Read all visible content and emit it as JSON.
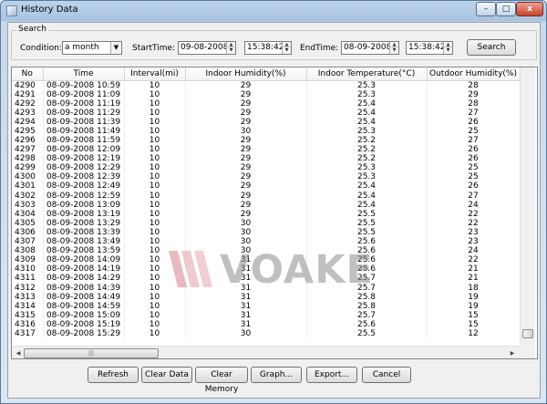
{
  "window": {
    "title": "History Data",
    "min": "–",
    "max": "□",
    "close": "x"
  },
  "search": {
    "group_label": "Search",
    "condition_label": "Condition:",
    "condition_value": "a month",
    "start_label": "StartTime:",
    "start_date": "09-08-2008",
    "start_time": "15:38:42",
    "end_label": "EndTime:",
    "end_date": "08-09-2008",
    "end_time": "15:38:42",
    "search_button": "Search"
  },
  "table": {
    "columns": [
      "No",
      "Time",
      "Interval(mi)",
      "Indoor Humidity(%)",
      "Indoor Temperature(°C)",
      "Outdoor Humidity(%)"
    ],
    "rows": [
      [
        "4290",
        "08-09-2008 10:59",
        "10",
        "29",
        "25.3",
        "28"
      ],
      [
        "4291",
        "08-09-2008 11:09",
        "10",
        "29",
        "25.3",
        "29"
      ],
      [
        "4292",
        "08-09-2008 11:19",
        "10",
        "29",
        "25.4",
        "28"
      ],
      [
        "4293",
        "08-09-2008 11:29",
        "10",
        "29",
        "25.4",
        "27"
      ],
      [
        "4294",
        "08-09-2008 11:39",
        "10",
        "29",
        "25.4",
        "26"
      ],
      [
        "4295",
        "08-09-2008 11:49",
        "10",
        "30",
        "25.3",
        "25"
      ],
      [
        "4296",
        "08-09-2008 11:59",
        "10",
        "29",
        "25.2",
        "27"
      ],
      [
        "4297",
        "08-09-2008 12:09",
        "10",
        "29",
        "25.2",
        "26"
      ],
      [
        "4298",
        "08-09-2008 12:19",
        "10",
        "29",
        "25.2",
        "26"
      ],
      [
        "4299",
        "08-09-2008 12:29",
        "10",
        "29",
        "25.3",
        "25"
      ],
      [
        "4300",
        "08-09-2008 12:39",
        "10",
        "29",
        "25.3",
        "25"
      ],
      [
        "4301",
        "08-09-2008 12:49",
        "10",
        "29",
        "25.4",
        "26"
      ],
      [
        "4302",
        "08-09-2008 12:59",
        "10",
        "29",
        "25.4",
        "27"
      ],
      [
        "4303",
        "08-09-2008 13:09",
        "10",
        "29",
        "25.4",
        "24"
      ],
      [
        "4304",
        "08-09-2008 13:19",
        "10",
        "29",
        "25.5",
        "22"
      ],
      [
        "4305",
        "08-09-2008 13:29",
        "10",
        "30",
        "25.5",
        "22"
      ],
      [
        "4306",
        "08-09-2008 13:39",
        "10",
        "30",
        "25.5",
        "23"
      ],
      [
        "4307",
        "08-09-2008 13:49",
        "10",
        "30",
        "25.6",
        "23"
      ],
      [
        "4308",
        "08-09-2008 13:59",
        "10",
        "30",
        "25.6",
        "24"
      ],
      [
        "4309",
        "08-09-2008 14:09",
        "10",
        "31",
        "25.6",
        "22"
      ],
      [
        "4310",
        "08-09-2008 14:19",
        "10",
        "31",
        "25.6",
        "21"
      ],
      [
        "4311",
        "08-09-2008 14:29",
        "10",
        "31",
        "25.7",
        "21"
      ],
      [
        "4312",
        "08-09-2008 14:39",
        "10",
        "31",
        "25.7",
        "18"
      ],
      [
        "4313",
        "08-09-2008 14:49",
        "10",
        "31",
        "25.8",
        "19"
      ],
      [
        "4314",
        "08-09-2008 14:59",
        "10",
        "31",
        "25.8",
        "19"
      ],
      [
        "4315",
        "08-09-2008 15:09",
        "10",
        "31",
        "25.7",
        "15"
      ],
      [
        "4316",
        "08-09-2008 15:19",
        "10",
        "31",
        "25.6",
        "15"
      ],
      [
        "4317",
        "08-09-2008 15:29",
        "10",
        "30",
        "25.5",
        "12"
      ]
    ]
  },
  "watermark": "VOAKE",
  "buttons": {
    "refresh": "Refresh",
    "clear_data": "Clear Data",
    "clear_memory": "Clear Memory",
    "graph": "Graph...",
    "export": "Export...",
    "cancel": "Cancel"
  },
  "colors": {
    "watermark_red": "#d9808c",
    "watermark_gray": "#8d8d8d",
    "window_frame": "#a9c4e1"
  }
}
